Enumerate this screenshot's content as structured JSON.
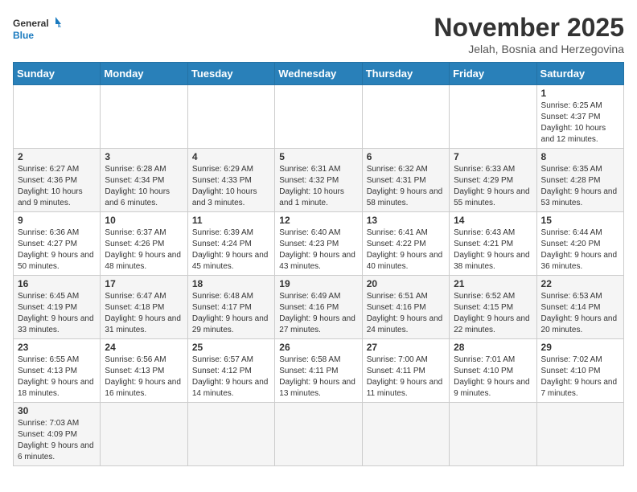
{
  "header": {
    "logo_general": "General",
    "logo_blue": "Blue",
    "month_title": "November 2025",
    "subtitle": "Jelah, Bosnia and Herzegovina"
  },
  "weekdays": [
    "Sunday",
    "Monday",
    "Tuesday",
    "Wednesday",
    "Thursday",
    "Friday",
    "Saturday"
  ],
  "weeks": [
    [
      {
        "day": "",
        "info": ""
      },
      {
        "day": "",
        "info": ""
      },
      {
        "day": "",
        "info": ""
      },
      {
        "day": "",
        "info": ""
      },
      {
        "day": "",
        "info": ""
      },
      {
        "day": "",
        "info": ""
      },
      {
        "day": "1",
        "info": "Sunrise: 6:25 AM\nSunset: 4:37 PM\nDaylight: 10 hours and 12 minutes."
      }
    ],
    [
      {
        "day": "2",
        "info": "Sunrise: 6:27 AM\nSunset: 4:36 PM\nDaylight: 10 hours and 9 minutes."
      },
      {
        "day": "3",
        "info": "Sunrise: 6:28 AM\nSunset: 4:34 PM\nDaylight: 10 hours and 6 minutes."
      },
      {
        "day": "4",
        "info": "Sunrise: 6:29 AM\nSunset: 4:33 PM\nDaylight: 10 hours and 3 minutes."
      },
      {
        "day": "5",
        "info": "Sunrise: 6:31 AM\nSunset: 4:32 PM\nDaylight: 10 hours and 1 minute."
      },
      {
        "day": "6",
        "info": "Sunrise: 6:32 AM\nSunset: 4:31 PM\nDaylight: 9 hours and 58 minutes."
      },
      {
        "day": "7",
        "info": "Sunrise: 6:33 AM\nSunset: 4:29 PM\nDaylight: 9 hours and 55 minutes."
      },
      {
        "day": "8",
        "info": "Sunrise: 6:35 AM\nSunset: 4:28 PM\nDaylight: 9 hours and 53 minutes."
      }
    ],
    [
      {
        "day": "9",
        "info": "Sunrise: 6:36 AM\nSunset: 4:27 PM\nDaylight: 9 hours and 50 minutes."
      },
      {
        "day": "10",
        "info": "Sunrise: 6:37 AM\nSunset: 4:26 PM\nDaylight: 9 hours and 48 minutes."
      },
      {
        "day": "11",
        "info": "Sunrise: 6:39 AM\nSunset: 4:24 PM\nDaylight: 9 hours and 45 minutes."
      },
      {
        "day": "12",
        "info": "Sunrise: 6:40 AM\nSunset: 4:23 PM\nDaylight: 9 hours and 43 minutes."
      },
      {
        "day": "13",
        "info": "Sunrise: 6:41 AM\nSunset: 4:22 PM\nDaylight: 9 hours and 40 minutes."
      },
      {
        "day": "14",
        "info": "Sunrise: 6:43 AM\nSunset: 4:21 PM\nDaylight: 9 hours and 38 minutes."
      },
      {
        "day": "15",
        "info": "Sunrise: 6:44 AM\nSunset: 4:20 PM\nDaylight: 9 hours and 36 minutes."
      }
    ],
    [
      {
        "day": "16",
        "info": "Sunrise: 6:45 AM\nSunset: 4:19 PM\nDaylight: 9 hours and 33 minutes."
      },
      {
        "day": "17",
        "info": "Sunrise: 6:47 AM\nSunset: 4:18 PM\nDaylight: 9 hours and 31 minutes."
      },
      {
        "day": "18",
        "info": "Sunrise: 6:48 AM\nSunset: 4:17 PM\nDaylight: 9 hours and 29 minutes."
      },
      {
        "day": "19",
        "info": "Sunrise: 6:49 AM\nSunset: 4:16 PM\nDaylight: 9 hours and 27 minutes."
      },
      {
        "day": "20",
        "info": "Sunrise: 6:51 AM\nSunset: 4:16 PM\nDaylight: 9 hours and 24 minutes."
      },
      {
        "day": "21",
        "info": "Sunrise: 6:52 AM\nSunset: 4:15 PM\nDaylight: 9 hours and 22 minutes."
      },
      {
        "day": "22",
        "info": "Sunrise: 6:53 AM\nSunset: 4:14 PM\nDaylight: 9 hours and 20 minutes."
      }
    ],
    [
      {
        "day": "23",
        "info": "Sunrise: 6:55 AM\nSunset: 4:13 PM\nDaylight: 9 hours and 18 minutes."
      },
      {
        "day": "24",
        "info": "Sunrise: 6:56 AM\nSunset: 4:13 PM\nDaylight: 9 hours and 16 minutes."
      },
      {
        "day": "25",
        "info": "Sunrise: 6:57 AM\nSunset: 4:12 PM\nDaylight: 9 hours and 14 minutes."
      },
      {
        "day": "26",
        "info": "Sunrise: 6:58 AM\nSunset: 4:11 PM\nDaylight: 9 hours and 13 minutes."
      },
      {
        "day": "27",
        "info": "Sunrise: 7:00 AM\nSunset: 4:11 PM\nDaylight: 9 hours and 11 minutes."
      },
      {
        "day": "28",
        "info": "Sunrise: 7:01 AM\nSunset: 4:10 PM\nDaylight: 9 hours and 9 minutes."
      },
      {
        "day": "29",
        "info": "Sunrise: 7:02 AM\nSunset: 4:10 PM\nDaylight: 9 hours and 7 minutes."
      }
    ],
    [
      {
        "day": "30",
        "info": "Sunrise: 7:03 AM\nSunset: 4:09 PM\nDaylight: 9 hours and 6 minutes."
      },
      {
        "day": "",
        "info": ""
      },
      {
        "day": "",
        "info": ""
      },
      {
        "day": "",
        "info": ""
      },
      {
        "day": "",
        "info": ""
      },
      {
        "day": "",
        "info": ""
      },
      {
        "day": "",
        "info": ""
      }
    ]
  ]
}
